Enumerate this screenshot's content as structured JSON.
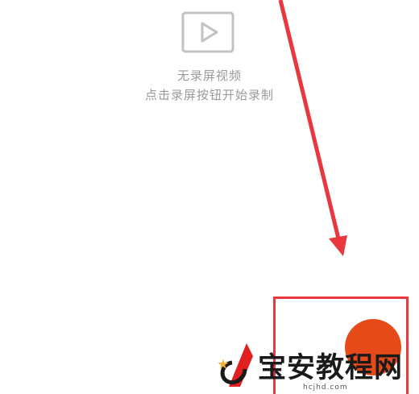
{
  "empty_state": {
    "icon": "video-play-icon",
    "title": "无录屏视频",
    "hint": "点击录屏按钮开始录制"
  },
  "record_button": {
    "icon": "record-icon",
    "color": "#e64a19"
  },
  "annotation": {
    "arrow_color": "#e8383d",
    "box_color": "#e8383d"
  },
  "watermark": {
    "brand": "宝安教程网",
    "url": "hcjhd.com"
  }
}
